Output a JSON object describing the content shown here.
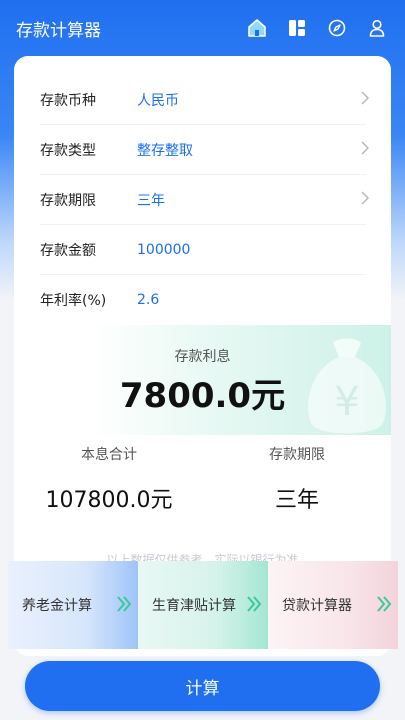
{
  "app": {
    "title": "存款计算器"
  },
  "header": {
    "icons": [
      "home-icon",
      "dashboard-icon",
      "discover-icon",
      "user-icon"
    ]
  },
  "form": {
    "currency": {
      "label": "存款币种",
      "value": "人民币"
    },
    "type": {
      "label": "存款类型",
      "value": "整存整取"
    },
    "term": {
      "label": "存款期限",
      "value": "三年"
    },
    "amount": {
      "label": "存款金额",
      "value": "100000"
    },
    "rate": {
      "label": "年利率(%)",
      "value": "2.6"
    }
  },
  "result": {
    "interest_label": "存款利息",
    "interest_value": "7800.0元",
    "total_label": "本息合计",
    "total_value": "107800.0元",
    "term_label": "存款期限",
    "term_value": "三年"
  },
  "disclaimer": "以上数据仅供参考，实际以银行为准",
  "promos": [
    {
      "label": "养老金计算"
    },
    {
      "label": "生育津贴计算"
    },
    {
      "label": "贷款计算器"
    }
  ],
  "calculate_button": "计算",
  "colors": {
    "primary": "#1f6ff0",
    "accent_green": "#3cc99a"
  }
}
